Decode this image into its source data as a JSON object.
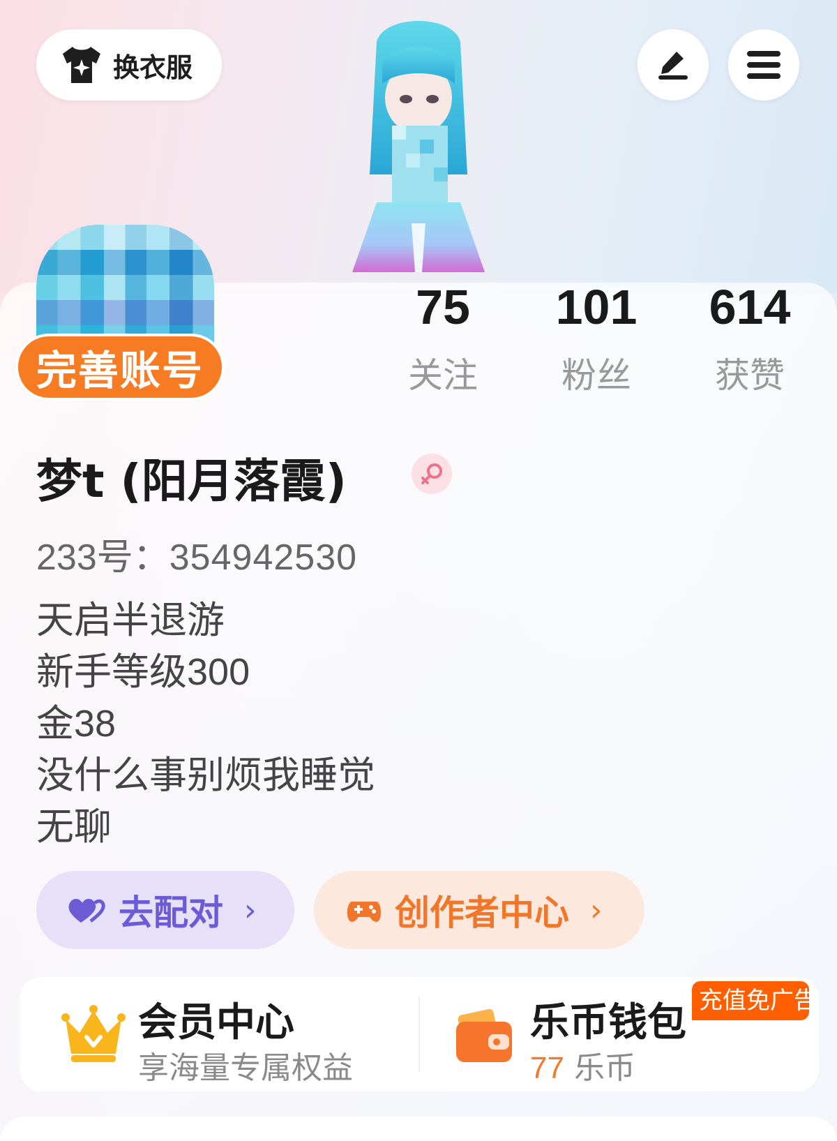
{
  "header": {
    "change_clothes_label": "换衣服",
    "edit_icon": "pen-icon",
    "menu_icon": "hamburger-menu-icon"
  },
  "profile": {
    "complete_account_label": "完善账号",
    "nickname": "梦t (阳月落霞)",
    "gender": "female",
    "uid_label": "233号：",
    "uid_value": "354942530",
    "bio_lines": [
      "天启半退游",
      "新手等级300",
      "金38",
      "没什么事别烦我睡觉",
      "无聊"
    ]
  },
  "stats": [
    {
      "value": "75",
      "label": "关注"
    },
    {
      "value": "101",
      "label": "粉丝"
    },
    {
      "value": "614",
      "label": "获赞"
    }
  ],
  "actions": {
    "match_label": "去配对",
    "creator_label": "创作者中心",
    "chevron": "›"
  },
  "vip": {
    "title": "会员中心",
    "subtitle": "享海量专属权益"
  },
  "wallet": {
    "title": "乐币钱包",
    "coin_amount": "77",
    "coin_unit": "乐币",
    "promo_tag": "充值免广告"
  },
  "colors": {
    "accent_orange": "#f77b23",
    "match_purple": "#6b5cd6",
    "creator_orange": "#f2762a",
    "promo_red": "#ff5f00"
  }
}
